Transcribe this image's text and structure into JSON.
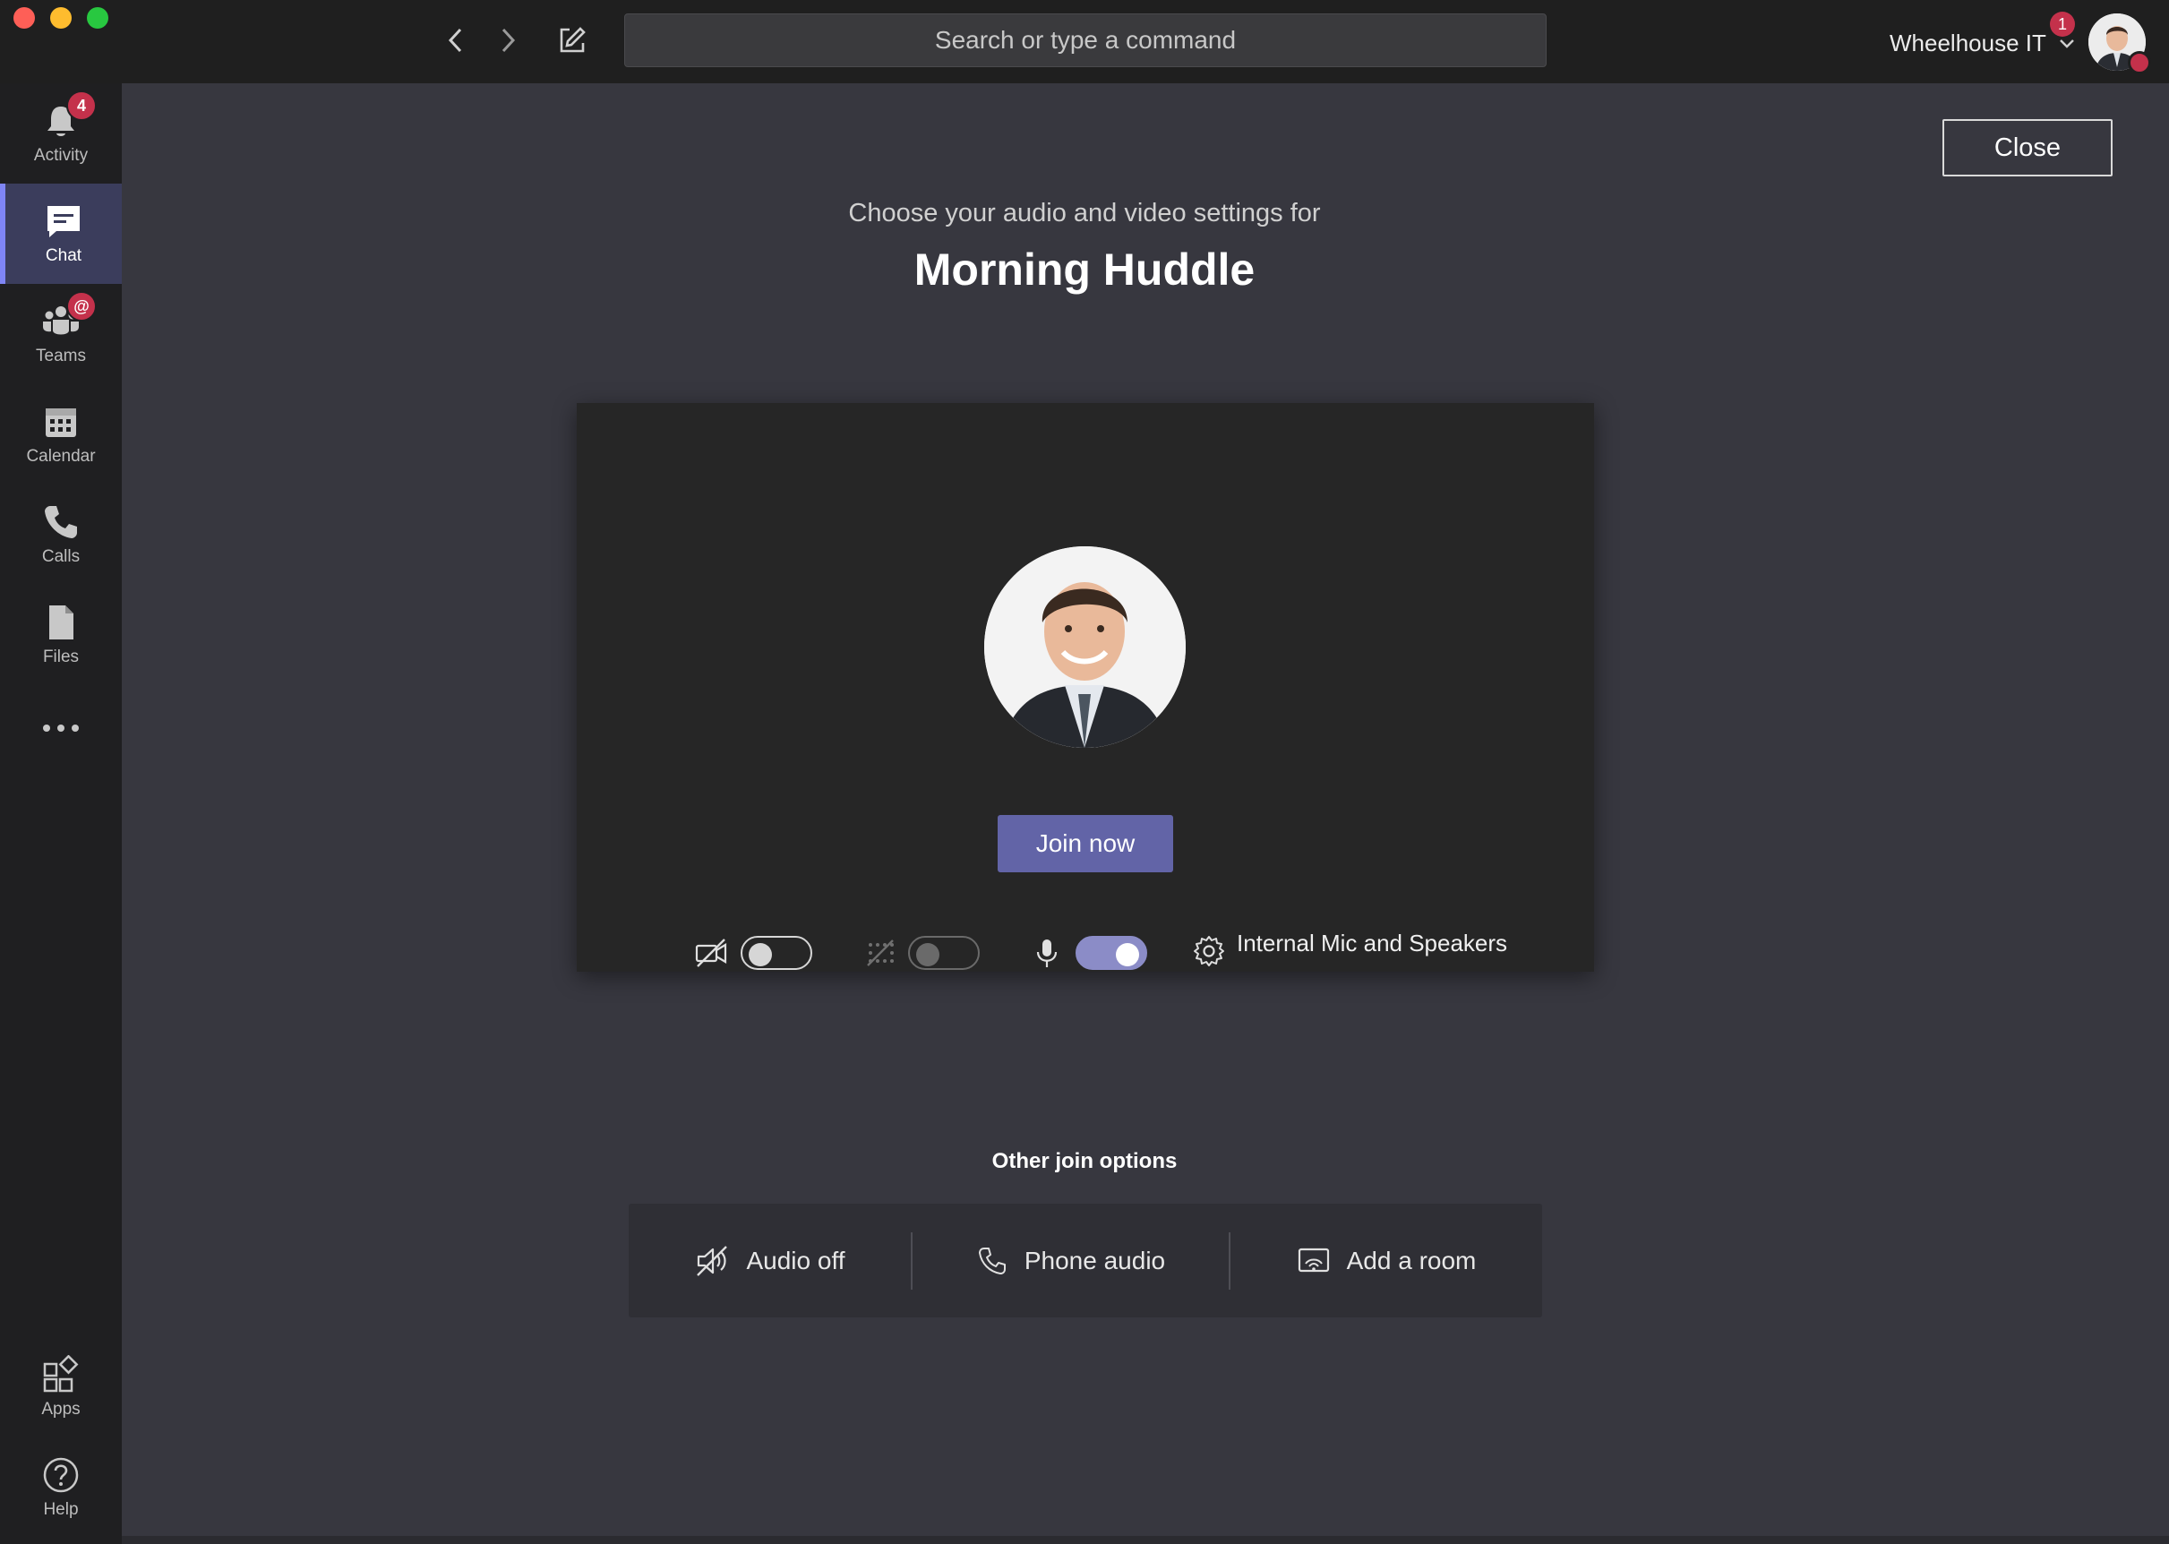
{
  "titlebar": {
    "search_placeholder": "Search or type a command",
    "org_name": "Wheelhouse IT",
    "org_badge": "1"
  },
  "rail": {
    "items": [
      {
        "label": "Activity",
        "badge": "4",
        "icon": "bell-icon"
      },
      {
        "label": "Chat",
        "icon": "chat-icon",
        "active": true
      },
      {
        "label": "Teams",
        "badge": "@",
        "icon": "teams-icon"
      },
      {
        "label": "Calendar",
        "icon": "calendar-icon"
      },
      {
        "label": "Calls",
        "icon": "phone-icon"
      },
      {
        "label": "Files",
        "icon": "file-icon"
      },
      {
        "label": "Apps",
        "icon": "apps-icon"
      },
      {
        "label": "Help",
        "icon": "help-icon"
      }
    ]
  },
  "prejoin": {
    "close_label": "Close",
    "subtitle": "Choose your audio and video settings for",
    "meeting_title": "Morning Huddle",
    "join_label": "Join now",
    "camera_on": false,
    "background_blur_on": false,
    "mic_on": true,
    "device_label": "Internal Mic and Speakers"
  },
  "other_options": {
    "title": "Other join options",
    "items": [
      {
        "label": "Audio off",
        "icon": "speaker-off-icon"
      },
      {
        "label": "Phone audio",
        "icon": "phone-icon"
      },
      {
        "label": "Add a room",
        "icon": "cast-room-icon"
      }
    ]
  },
  "colors": {
    "accent": "#6264a7",
    "badge": "#c4314b",
    "main_bg": "#37373f",
    "rail_bg": "#1f1f21"
  }
}
